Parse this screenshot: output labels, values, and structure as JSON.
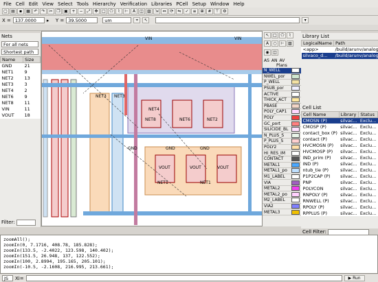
{
  "menubar": [
    "File",
    "Cell",
    "Edit",
    "View",
    "Select",
    "Tools",
    "Hierarchy",
    "Verification",
    "Libraries",
    "PCell",
    "Setup",
    "Window",
    "Help"
  ],
  "coords": {
    "x_label": "X =",
    "x_value": "137.0000",
    "y_label": "Y =",
    "y_value": "39.5000",
    "unit": "um"
  },
  "nets": {
    "title": "Nets",
    "filter_mode": "For all nets",
    "path_mode": "Shortest path",
    "columns": [
      "Name",
      "Size"
    ],
    "rows": [
      [
        "GND",
        "21"
      ],
      [
        "NET1",
        "9"
      ],
      [
        "NET2",
        "13"
      ],
      [
        "NET3",
        "3"
      ],
      [
        "NET4",
        "2"
      ],
      [
        "NET6",
        "9"
      ],
      [
        "NET8",
        "11"
      ],
      [
        "VIN",
        "11"
      ],
      [
        "VOUT",
        "18"
      ]
    ],
    "filter_label": "Filter:"
  },
  "canvas_labels": {
    "net3": "NET3",
    "net4": "NET4",
    "net1": "NET1",
    "net2": "NET2",
    "net6": "NET6",
    "net8": "NET8",
    "gnd": "GND",
    "vin": "VIN",
    "vout": "VOUT"
  },
  "tools": {
    "tabs": [
      "AS",
      "AN",
      "AV"
    ],
    "tab_active": "Plans",
    "layers_header": "AV",
    "layers": [
      {
        "name": "N_WELL",
        "color": "#ffffff",
        "selected": true
      },
      {
        "name": "NWEL_por",
        "color": "#cfe6cf"
      },
      {
        "name": "P_WELL",
        "color": "#f3e1a3"
      },
      {
        "name": "PSUB_por",
        "color": "#f0f0ff"
      },
      {
        "name": "ACTIVE",
        "color": "#ffffff"
      },
      {
        "name": "THICK_ACT",
        "color": "#ffe8a0"
      },
      {
        "name": "PBASE",
        "color": "#f2d5c6"
      },
      {
        "name": "POLY_CAP1",
        "color": "#ffd7ff"
      },
      {
        "name": "POLY",
        "color": "#f04040"
      },
      {
        "name": "GC_port",
        "color": "#ff8080"
      },
      {
        "name": "SILICIDE_BL",
        "color": "#ffe0ff"
      },
      {
        "name": "N_PLUS_S",
        "color": "#e8f4e8"
      },
      {
        "name": "P_PLUS_S",
        "color": "#ffd0d0"
      },
      {
        "name": "POLY2",
        "color": "#ffe0a8"
      },
      {
        "name": "HI_RES_IM",
        "color": "#ffffff"
      },
      {
        "name": "CONTACT",
        "color": "#555555"
      },
      {
        "name": "METAL1",
        "color": "#4aa8ff"
      },
      {
        "name": "METAL1_po",
        "color": "#bfe0ff"
      },
      {
        "name": "M1_LABEL",
        "color": "#ffffff"
      },
      {
        "name": "VIA",
        "color": "#a060c0"
      },
      {
        "name": "METAL2",
        "color": "#f040f0"
      },
      {
        "name": "METAL2_po",
        "color": "#ffd0ff"
      },
      {
        "name": "M2_LABEL",
        "color": "#ffffff"
      },
      {
        "name": "VIA2",
        "color": "#8080ff"
      },
      {
        "name": "METAL3",
        "color": "#f0c000"
      }
    ]
  },
  "library": {
    "title": "Library List",
    "columns": [
      "LogicalName",
      "Path"
    ],
    "rows": [
      [
        "<app>",
        "/build/arunv/analog-de"
      ],
      [
        "silvaco_d...",
        "/build/arunv/analog-de"
      ]
    ]
  },
  "cells": {
    "title": "Cell List",
    "columns": [
      "Cell Name",
      "Library",
      "Status"
    ],
    "rows": [
      [
        "CMOSN (P)",
        "silvac...",
        "Exclu..."
      ],
      [
        "CMOSP (P)",
        "silvac...",
        "Exclu..."
      ],
      [
        "contact_box (P)",
        "silvac...",
        "Exclu..."
      ],
      [
        "contact (P)",
        "silvac...",
        "Exclu..."
      ],
      [
        "HVCMOSN (P)",
        "silvac...",
        "Exclu..."
      ],
      [
        "HVCMOSP (P)",
        "silvac...",
        "Exclu..."
      ],
      [
        "IND_prim (P)",
        "silvac...",
        "Exclu..."
      ],
      [
        "IND (P)",
        "silvac...",
        "Exclu..."
      ],
      [
        "ntub_tie (P)",
        "silvac...",
        "Exclu..."
      ],
      [
        "P1P2CAP (P)",
        "silvac...",
        "Exclu..."
      ],
      [
        "PNP",
        "silvac...",
        "Exclu..."
      ],
      [
        "POLYCON",
        "silvac...",
        "Exclu..."
      ],
      [
        "RNPOLY (P)",
        "silvac...",
        "Exclu..."
      ],
      [
        "RNWELL (P)",
        "silvac...",
        "Exclu..."
      ],
      [
        "RPOLY (P)",
        "silvac...",
        "Exclu..."
      ],
      [
        "RPPLUS (P)",
        "silvac...",
        "Exclu..."
      ]
    ],
    "filter_label": "Cell Filter:"
  },
  "console": {
    "lines": [
      "zoomAll();",
      "zoomIn(0, 7.1716, 408.78, 185.828);",
      "zoomIn(133.5, -2.4022, 123.598, 140.402);",
      "zoomIn(151.5, 26.948, 137, 122.552);",
      "zoomIn(100, 2.8994, 195.165, 205.101);",
      "zoomIn(-10.5, -2.1608, 216.995, 213.661);"
    ]
  },
  "status": {
    "lang": "JS",
    "xi_label": "Xi=",
    "run": "Run"
  }
}
